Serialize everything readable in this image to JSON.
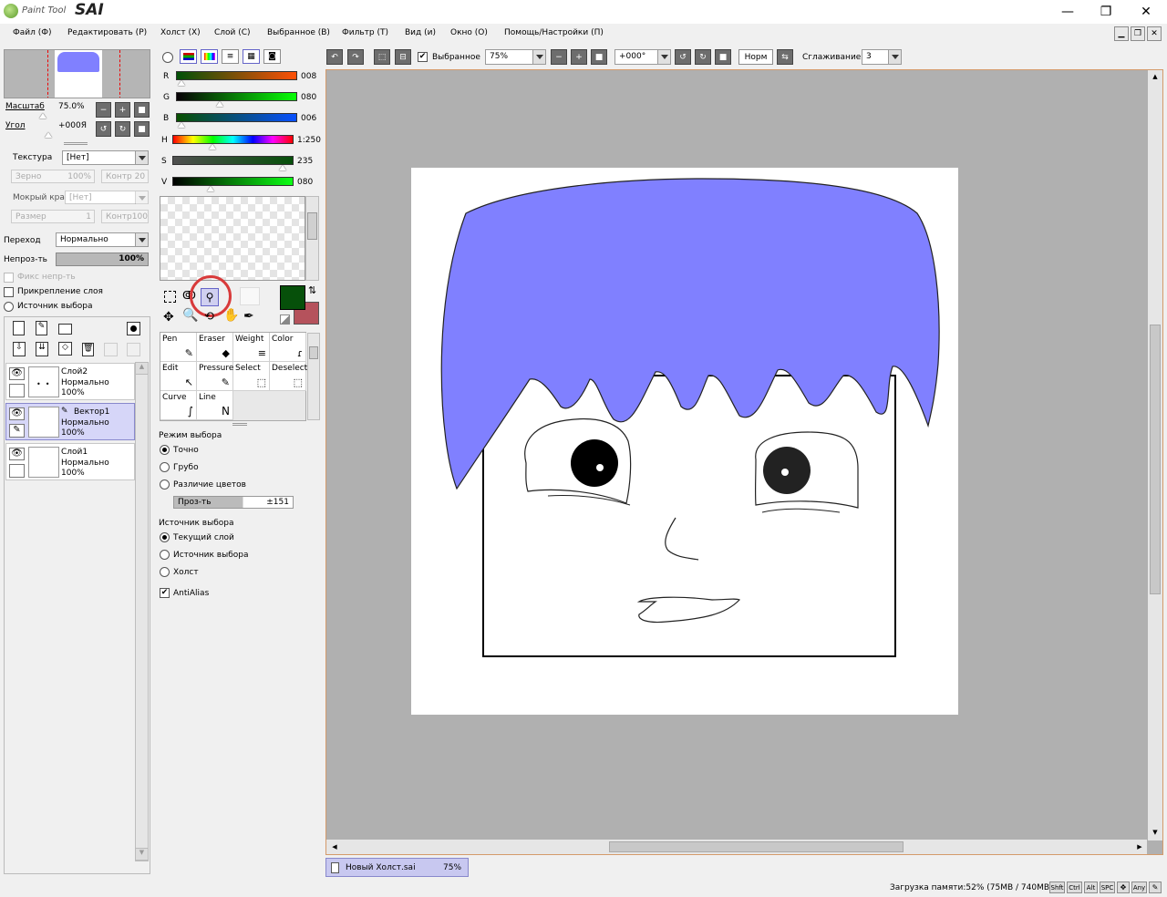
{
  "app": {
    "logo_small": "Paint Tool",
    "logo_big": "SAI"
  },
  "window": {
    "minimize": "—",
    "restore": "❐",
    "close": "✕"
  },
  "menu": [
    "Файл (Ф)",
    "Редактировать (Р)",
    "Холст (Х)",
    "Слой (С)",
    "Выбранное (В)",
    "Фильтр (Т)",
    "Вид (и)",
    "Окно (О)",
    "Помощь/Настройки (П)"
  ],
  "navigator": {
    "zoom_label": "Масштаб",
    "zoom_value": "75.0%",
    "angle_label": "Угол",
    "angle_value": "+000Я"
  },
  "brush": {
    "texture_label": "Текстура",
    "texture_value": "[Нет]",
    "grain_label": "Зерно",
    "grain_value": "100%",
    "contr1": "Контр 20",
    "wet_label": "Мокрый край",
    "wet_value": "[Нет]",
    "size_label": "Размер",
    "size_value": "1",
    "contr2": "Контр100",
    "blend_label": "Переход",
    "blend_value": "Нормально",
    "opacity_label": "Непроз-ть",
    "opacity_value": "100%",
    "fix_opacity": "Фикс непр-ть",
    "clip_layer": "Прикрепление слоя",
    "sel_source": "Источник выбора"
  },
  "layers": [
    {
      "name": "Слой2",
      "mode": "Нормально",
      "opacity": "100%"
    },
    {
      "name": "Вектор1",
      "mode": "Нормально",
      "opacity": "100%"
    },
    {
      "name": "Слой1",
      "mode": "Нормально",
      "opacity": "100%"
    }
  ],
  "color": {
    "rows": [
      {
        "label": "R",
        "value": "008"
      },
      {
        "label": "G",
        "value": "080"
      },
      {
        "label": "B",
        "value": "006"
      },
      {
        "label": "H",
        "value": "1:250"
      },
      {
        "label": "S",
        "value": "235"
      },
      {
        "label": "V",
        "value": "080"
      }
    ],
    "primary": "#06500a",
    "secondary": "#b5525c"
  },
  "tools": [
    {
      "name": "Pen"
    },
    {
      "name": "Eraser"
    },
    {
      "name": "Weight"
    },
    {
      "name": "Color"
    },
    {
      "name": "Edit"
    },
    {
      "name": "Pressure"
    },
    {
      "name": "Select"
    },
    {
      "name": "Deselect"
    },
    {
      "name": "Curve"
    },
    {
      "name": "Line"
    }
  ],
  "magic_wand": {
    "mode_title": "Режим выбора",
    "modes": [
      "Точно",
      "Грубо",
      "Различие цветов"
    ],
    "tol_label": "Проз-ть",
    "tol_value": "±151",
    "source_title": "Источник выбора",
    "sources": [
      "Текущий слой",
      "Источник выбора",
      "Холст"
    ],
    "antialias": "AntiAlias"
  },
  "toolbar": {
    "selection_label": "Выбранное",
    "zoom": "75%",
    "angle": "+000°",
    "blend": "Норм",
    "smooth_label": "Сглаживание",
    "smooth_value": "3"
  },
  "document_tab": {
    "name": "Новый Холст.sai",
    "zoom": "75%"
  },
  "status": {
    "memory": "Загрузка памяти:52% (75MB / 740MB)",
    "keys": [
      "Shft",
      "Ctrl",
      "Alt",
      "SPC"
    ],
    "any": "Any"
  }
}
